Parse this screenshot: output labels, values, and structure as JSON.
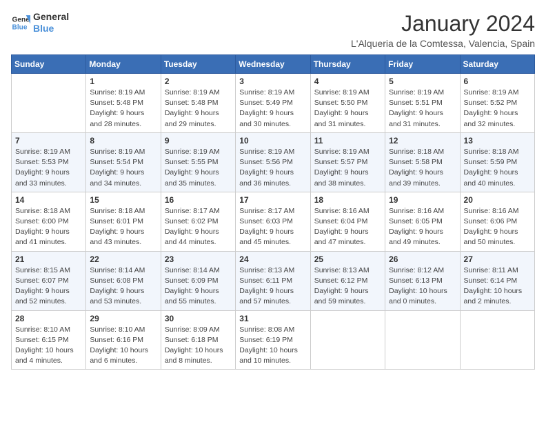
{
  "logo": {
    "line1": "General",
    "line2": "Blue"
  },
  "title": "January 2024",
  "subtitle": "L'Alqueria de la Comtessa, Valencia, Spain",
  "weekdays": [
    "Sunday",
    "Monday",
    "Tuesday",
    "Wednesday",
    "Thursday",
    "Friday",
    "Saturday"
  ],
  "weeks": [
    [
      {
        "day": "",
        "info": ""
      },
      {
        "day": "1",
        "info": "Sunrise: 8:19 AM\nSunset: 5:48 PM\nDaylight: 9 hours\nand 28 minutes."
      },
      {
        "day": "2",
        "info": "Sunrise: 8:19 AM\nSunset: 5:48 PM\nDaylight: 9 hours\nand 29 minutes."
      },
      {
        "day": "3",
        "info": "Sunrise: 8:19 AM\nSunset: 5:49 PM\nDaylight: 9 hours\nand 30 minutes."
      },
      {
        "day": "4",
        "info": "Sunrise: 8:19 AM\nSunset: 5:50 PM\nDaylight: 9 hours\nand 31 minutes."
      },
      {
        "day": "5",
        "info": "Sunrise: 8:19 AM\nSunset: 5:51 PM\nDaylight: 9 hours\nand 31 minutes."
      },
      {
        "day": "6",
        "info": "Sunrise: 8:19 AM\nSunset: 5:52 PM\nDaylight: 9 hours\nand 32 minutes."
      }
    ],
    [
      {
        "day": "7",
        "info": "Sunrise: 8:19 AM\nSunset: 5:53 PM\nDaylight: 9 hours\nand 33 minutes."
      },
      {
        "day": "8",
        "info": "Sunrise: 8:19 AM\nSunset: 5:54 PM\nDaylight: 9 hours\nand 34 minutes."
      },
      {
        "day": "9",
        "info": "Sunrise: 8:19 AM\nSunset: 5:55 PM\nDaylight: 9 hours\nand 35 minutes."
      },
      {
        "day": "10",
        "info": "Sunrise: 8:19 AM\nSunset: 5:56 PM\nDaylight: 9 hours\nand 36 minutes."
      },
      {
        "day": "11",
        "info": "Sunrise: 8:19 AM\nSunset: 5:57 PM\nDaylight: 9 hours\nand 38 minutes."
      },
      {
        "day": "12",
        "info": "Sunrise: 8:18 AM\nSunset: 5:58 PM\nDaylight: 9 hours\nand 39 minutes."
      },
      {
        "day": "13",
        "info": "Sunrise: 8:18 AM\nSunset: 5:59 PM\nDaylight: 9 hours\nand 40 minutes."
      }
    ],
    [
      {
        "day": "14",
        "info": "Sunrise: 8:18 AM\nSunset: 6:00 PM\nDaylight: 9 hours\nand 41 minutes."
      },
      {
        "day": "15",
        "info": "Sunrise: 8:18 AM\nSunset: 6:01 PM\nDaylight: 9 hours\nand 43 minutes."
      },
      {
        "day": "16",
        "info": "Sunrise: 8:17 AM\nSunset: 6:02 PM\nDaylight: 9 hours\nand 44 minutes."
      },
      {
        "day": "17",
        "info": "Sunrise: 8:17 AM\nSunset: 6:03 PM\nDaylight: 9 hours\nand 45 minutes."
      },
      {
        "day": "18",
        "info": "Sunrise: 8:16 AM\nSunset: 6:04 PM\nDaylight: 9 hours\nand 47 minutes."
      },
      {
        "day": "19",
        "info": "Sunrise: 8:16 AM\nSunset: 6:05 PM\nDaylight: 9 hours\nand 49 minutes."
      },
      {
        "day": "20",
        "info": "Sunrise: 8:16 AM\nSunset: 6:06 PM\nDaylight: 9 hours\nand 50 minutes."
      }
    ],
    [
      {
        "day": "21",
        "info": "Sunrise: 8:15 AM\nSunset: 6:07 PM\nDaylight: 9 hours\nand 52 minutes."
      },
      {
        "day": "22",
        "info": "Sunrise: 8:14 AM\nSunset: 6:08 PM\nDaylight: 9 hours\nand 53 minutes."
      },
      {
        "day": "23",
        "info": "Sunrise: 8:14 AM\nSunset: 6:09 PM\nDaylight: 9 hours\nand 55 minutes."
      },
      {
        "day": "24",
        "info": "Sunrise: 8:13 AM\nSunset: 6:11 PM\nDaylight: 9 hours\nand 57 minutes."
      },
      {
        "day": "25",
        "info": "Sunrise: 8:13 AM\nSunset: 6:12 PM\nDaylight: 9 hours\nand 59 minutes."
      },
      {
        "day": "26",
        "info": "Sunrise: 8:12 AM\nSunset: 6:13 PM\nDaylight: 10 hours\nand 0 minutes."
      },
      {
        "day": "27",
        "info": "Sunrise: 8:11 AM\nSunset: 6:14 PM\nDaylight: 10 hours\nand 2 minutes."
      }
    ],
    [
      {
        "day": "28",
        "info": "Sunrise: 8:10 AM\nSunset: 6:15 PM\nDaylight: 10 hours\nand 4 minutes."
      },
      {
        "day": "29",
        "info": "Sunrise: 8:10 AM\nSunset: 6:16 PM\nDaylight: 10 hours\nand 6 minutes."
      },
      {
        "day": "30",
        "info": "Sunrise: 8:09 AM\nSunset: 6:18 PM\nDaylight: 10 hours\nand 8 minutes."
      },
      {
        "day": "31",
        "info": "Sunrise: 8:08 AM\nSunset: 6:19 PM\nDaylight: 10 hours\nand 10 minutes."
      },
      {
        "day": "",
        "info": ""
      },
      {
        "day": "",
        "info": ""
      },
      {
        "day": "",
        "info": ""
      }
    ]
  ]
}
